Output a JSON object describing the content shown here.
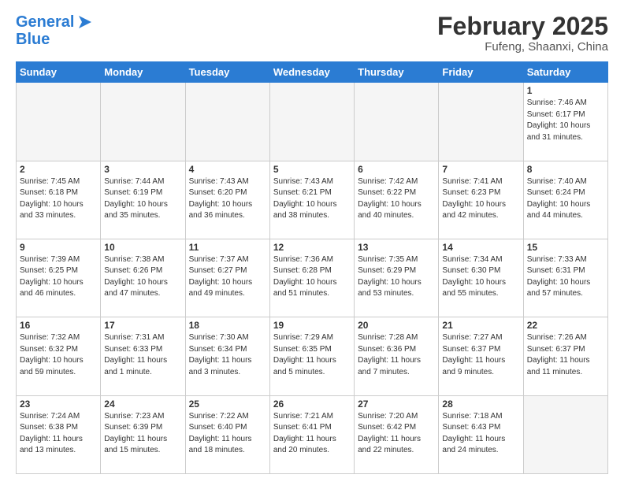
{
  "header": {
    "logo_line1": "General",
    "logo_line2": "Blue",
    "month": "February 2025",
    "location": "Fufeng, Shaanxi, China"
  },
  "weekdays": [
    "Sunday",
    "Monday",
    "Tuesday",
    "Wednesday",
    "Thursday",
    "Friday",
    "Saturday"
  ],
  "weeks": [
    [
      {
        "day": "",
        "info": ""
      },
      {
        "day": "",
        "info": ""
      },
      {
        "day": "",
        "info": ""
      },
      {
        "day": "",
        "info": ""
      },
      {
        "day": "",
        "info": ""
      },
      {
        "day": "",
        "info": ""
      },
      {
        "day": "1",
        "info": "Sunrise: 7:46 AM\nSunset: 6:17 PM\nDaylight: 10 hours and 31 minutes."
      }
    ],
    [
      {
        "day": "2",
        "info": "Sunrise: 7:45 AM\nSunset: 6:18 PM\nDaylight: 10 hours and 33 minutes."
      },
      {
        "day": "3",
        "info": "Sunrise: 7:44 AM\nSunset: 6:19 PM\nDaylight: 10 hours and 35 minutes."
      },
      {
        "day": "4",
        "info": "Sunrise: 7:43 AM\nSunset: 6:20 PM\nDaylight: 10 hours and 36 minutes."
      },
      {
        "day": "5",
        "info": "Sunrise: 7:43 AM\nSunset: 6:21 PM\nDaylight: 10 hours and 38 minutes."
      },
      {
        "day": "6",
        "info": "Sunrise: 7:42 AM\nSunset: 6:22 PM\nDaylight: 10 hours and 40 minutes."
      },
      {
        "day": "7",
        "info": "Sunrise: 7:41 AM\nSunset: 6:23 PM\nDaylight: 10 hours and 42 minutes."
      },
      {
        "day": "8",
        "info": "Sunrise: 7:40 AM\nSunset: 6:24 PM\nDaylight: 10 hours and 44 minutes."
      }
    ],
    [
      {
        "day": "9",
        "info": "Sunrise: 7:39 AM\nSunset: 6:25 PM\nDaylight: 10 hours and 46 minutes."
      },
      {
        "day": "10",
        "info": "Sunrise: 7:38 AM\nSunset: 6:26 PM\nDaylight: 10 hours and 47 minutes."
      },
      {
        "day": "11",
        "info": "Sunrise: 7:37 AM\nSunset: 6:27 PM\nDaylight: 10 hours and 49 minutes."
      },
      {
        "day": "12",
        "info": "Sunrise: 7:36 AM\nSunset: 6:28 PM\nDaylight: 10 hours and 51 minutes."
      },
      {
        "day": "13",
        "info": "Sunrise: 7:35 AM\nSunset: 6:29 PM\nDaylight: 10 hours and 53 minutes."
      },
      {
        "day": "14",
        "info": "Sunrise: 7:34 AM\nSunset: 6:30 PM\nDaylight: 10 hours and 55 minutes."
      },
      {
        "day": "15",
        "info": "Sunrise: 7:33 AM\nSunset: 6:31 PM\nDaylight: 10 hours and 57 minutes."
      }
    ],
    [
      {
        "day": "16",
        "info": "Sunrise: 7:32 AM\nSunset: 6:32 PM\nDaylight: 10 hours and 59 minutes."
      },
      {
        "day": "17",
        "info": "Sunrise: 7:31 AM\nSunset: 6:33 PM\nDaylight: 11 hours and 1 minute."
      },
      {
        "day": "18",
        "info": "Sunrise: 7:30 AM\nSunset: 6:34 PM\nDaylight: 11 hours and 3 minutes."
      },
      {
        "day": "19",
        "info": "Sunrise: 7:29 AM\nSunset: 6:35 PM\nDaylight: 11 hours and 5 minutes."
      },
      {
        "day": "20",
        "info": "Sunrise: 7:28 AM\nSunset: 6:36 PM\nDaylight: 11 hours and 7 minutes."
      },
      {
        "day": "21",
        "info": "Sunrise: 7:27 AM\nSunset: 6:37 PM\nDaylight: 11 hours and 9 minutes."
      },
      {
        "day": "22",
        "info": "Sunrise: 7:26 AM\nSunset: 6:37 PM\nDaylight: 11 hours and 11 minutes."
      }
    ],
    [
      {
        "day": "23",
        "info": "Sunrise: 7:24 AM\nSunset: 6:38 PM\nDaylight: 11 hours and 13 minutes."
      },
      {
        "day": "24",
        "info": "Sunrise: 7:23 AM\nSunset: 6:39 PM\nDaylight: 11 hours and 15 minutes."
      },
      {
        "day": "25",
        "info": "Sunrise: 7:22 AM\nSunset: 6:40 PM\nDaylight: 11 hours and 18 minutes."
      },
      {
        "day": "26",
        "info": "Sunrise: 7:21 AM\nSunset: 6:41 PM\nDaylight: 11 hours and 20 minutes."
      },
      {
        "day": "27",
        "info": "Sunrise: 7:20 AM\nSunset: 6:42 PM\nDaylight: 11 hours and 22 minutes."
      },
      {
        "day": "28",
        "info": "Sunrise: 7:18 AM\nSunset: 6:43 PM\nDaylight: 11 hours and 24 minutes."
      },
      {
        "day": "",
        "info": ""
      }
    ]
  ]
}
